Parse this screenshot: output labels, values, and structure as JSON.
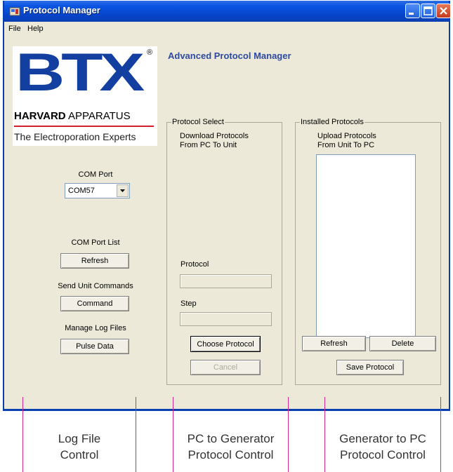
{
  "window": {
    "title": "Protocol Manager",
    "menu": [
      "File",
      "Help"
    ],
    "colors": {
      "titlebar": "#0a55e2",
      "body": "#ece9d8",
      "heading": "#2d4aa0",
      "logo_blue": "#1340a0",
      "logo_rule": "#d22030",
      "annotation_line": "#d42a8f"
    }
  },
  "logo": {
    "brand": "BTX",
    "registered": "®",
    "harvard_bold": "HARVARD",
    "harvard_rest": " APPARATUS",
    "tagline": "The Electroporation Experts"
  },
  "heading": "Advanced Protocol Manager",
  "left_panel": {
    "com_port_label": "COM Port",
    "com_port_value": "COM57",
    "com_port_list_label": "COM Port List",
    "refresh_button": "Refresh",
    "send_unit_commands_label": "Send Unit Commands",
    "command_button": "Command",
    "manage_log_files_label": "Manage Log Files",
    "pulse_data_button": "Pulse Data"
  },
  "protocol_select": {
    "group_title": "Protocol Select",
    "line1": "Download Protocols",
    "line2": "From PC To Unit",
    "protocol_label": "Protocol",
    "step_label": "Step",
    "choose_button": "Choose Protocol",
    "cancel_button": "Cancel"
  },
  "installed_protocols": {
    "group_title": "Installed Protocols",
    "line1": "Upload Protocols",
    "line2": "From Unit To PC",
    "refresh_button": "Refresh",
    "delete_button": "Delete",
    "save_button": "Save Protocol"
  },
  "annotations": {
    "left_line1": "Log File",
    "left_line2": "Control",
    "middle_line1": "PC to Generator",
    "middle_line2": "Protocol Control",
    "right_line1": "Generator to PC",
    "right_line2": "Protocol Control"
  }
}
